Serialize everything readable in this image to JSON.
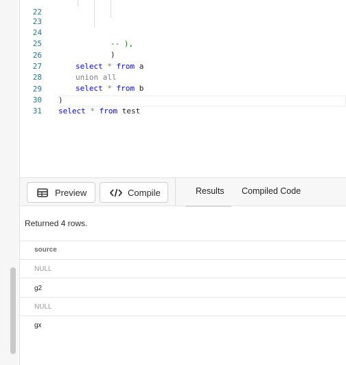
{
  "editor": {
    "lines": [
      {
        "num": "22",
        "code": ""
      },
      {
        "num": "23",
        "code": ""
      },
      {
        "num": "24",
        "code": "-- ),"
      },
      {
        "num": "25",
        "code": ")"
      },
      {
        "num": "26",
        "kw1": "select",
        "op": " * ",
        "kw2": "from",
        "rest": " a"
      },
      {
        "num": "27",
        "code": "union all"
      },
      {
        "num": "28",
        "kw1": "select",
        "op": " * ",
        "kw2": "from",
        "rest": " b"
      },
      {
        "num": "29",
        "code": ")"
      },
      {
        "num": "30",
        "kw1": "select",
        "op": " * ",
        "kw2": "from",
        "rest": " test"
      },
      {
        "num": "31",
        "code": ""
      }
    ]
  },
  "toolbar": {
    "preview_label": "Preview",
    "compile_label": "Compile",
    "tabs": [
      "Results",
      "Compiled Code"
    ]
  },
  "results": {
    "message": "Returned 4 rows.",
    "columns": [
      "source"
    ],
    "rows": [
      "NULL",
      "g2",
      "NULL",
      "gx"
    ]
  }
}
